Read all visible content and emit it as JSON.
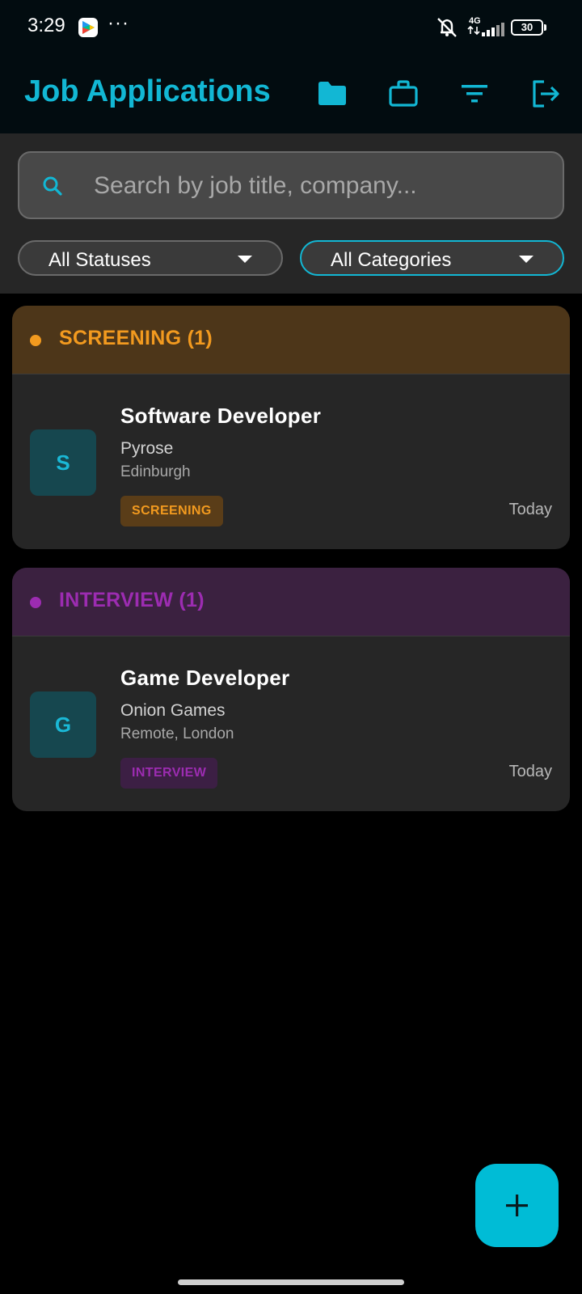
{
  "status_bar": {
    "time": "3:29",
    "more": "···",
    "network": "4G",
    "battery": "30",
    "battery_fraction": 0.3
  },
  "app_bar": {
    "title": "Job Applications",
    "icons": [
      "folder-icon",
      "briefcase-icon",
      "filter-icon",
      "logout-icon"
    ]
  },
  "search": {
    "placeholder": "Search by job title, company...",
    "value": ""
  },
  "filters": {
    "status": "All Statuses",
    "category": "All Categories"
  },
  "groups": [
    {
      "title": "SCREENING (1)",
      "color": "#f29a1f",
      "header_bg": "#4d3619",
      "badge_bg": "#5a3d18",
      "jobs": [
        {
          "initial": "S",
          "title": "Software Developer",
          "company": "Pyrose",
          "location": "Edinburgh",
          "status": "SCREENING",
          "date": "Today"
        }
      ]
    },
    {
      "title": "INTERVIEW (1)",
      "color": "#9c2cb1",
      "header_bg": "#3b2140",
      "badge_bg": "#3c1f44",
      "jobs": [
        {
          "initial": "G",
          "title": "Game Developer",
          "company": "Onion Games",
          "location": "Remote, London",
          "status": "INTERVIEW",
          "date": "Today"
        }
      ]
    }
  ],
  "fab": {
    "icon": "plus-icon"
  },
  "colors": {
    "accent": "#12b7d4",
    "app_bar_bg": "#020c10",
    "panel_bg": "#262626"
  }
}
